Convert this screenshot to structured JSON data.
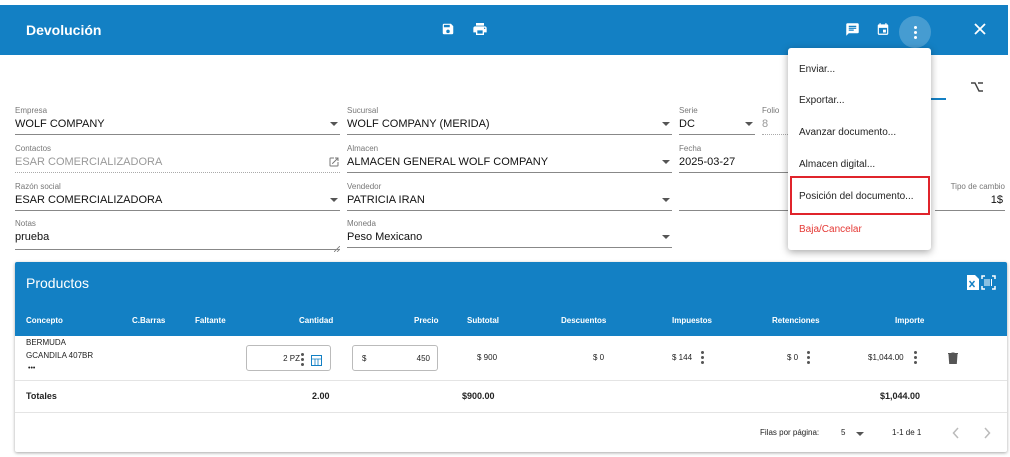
{
  "header": {
    "title": "Devolución"
  },
  "form": {
    "empresa": {
      "label": "Empresa",
      "value": "WOLF COMPANY"
    },
    "sucursal": {
      "label": "Sucursal",
      "value": "WOLF COMPANY (MERIDA)"
    },
    "serie": {
      "label": "Serie",
      "value": "DC"
    },
    "folio": {
      "label": "Folio",
      "value": "8"
    },
    "contactos": {
      "label": "Contactos",
      "value": "ESAR COMERCIALIZADORA"
    },
    "almacen": {
      "label": "Almacen",
      "value": "ALMACEN GENERAL WOLF COMPANY"
    },
    "fecha": {
      "label": "Fecha",
      "value": "2025-03-27"
    },
    "razon_social": {
      "label": "Razón social",
      "value": "ESAR COMERCIALIZADORA"
    },
    "vendedor": {
      "label": "Vendedor",
      "value": "PATRICIA IRAN"
    },
    "tipo_cambio": {
      "label": "Tipo de cambio",
      "value": "1$"
    },
    "notas": {
      "label": "Notas",
      "value": "prueba"
    },
    "moneda": {
      "label": "Moneda",
      "value": "Peso Mexicano"
    }
  },
  "menu": {
    "items": [
      "Enviar...",
      "Exportar...",
      "Avanzar documento...",
      "Almacen digital...",
      "Posición del documento...",
      "Baja/Cancelar"
    ]
  },
  "products": {
    "title": "Productos",
    "columns": [
      "Concepto",
      "C.Barras",
      "Faltante",
      "Cantidad",
      "Precio",
      "Subtotal",
      "Descuentos",
      "Impuestos",
      "Retenciones",
      "Importe"
    ],
    "row": {
      "concepto_line1": "BERMUDA",
      "concepto_line2": "GCANDILA 407BR",
      "concepto_more": "•••",
      "cantidad": "2 PZ",
      "precio_symbol": "$",
      "precio": "450",
      "subtotal": "$ 900",
      "descuentos": "$ 0",
      "impuestos": "$ 144",
      "retenciones": "$ 0",
      "importe": "$1,044.00"
    },
    "totals": {
      "label": "Totales",
      "cantidad": "2.00",
      "subtotal": "$900.00",
      "importe": "$1,044.00"
    },
    "pagination": {
      "rows_label": "Filas por página:",
      "rows_value": "5",
      "range": "1-1 de 1"
    }
  },
  "colors": {
    "primary": "#1380c4",
    "highlight": "#e0242b",
    "danger": "#e53935"
  }
}
